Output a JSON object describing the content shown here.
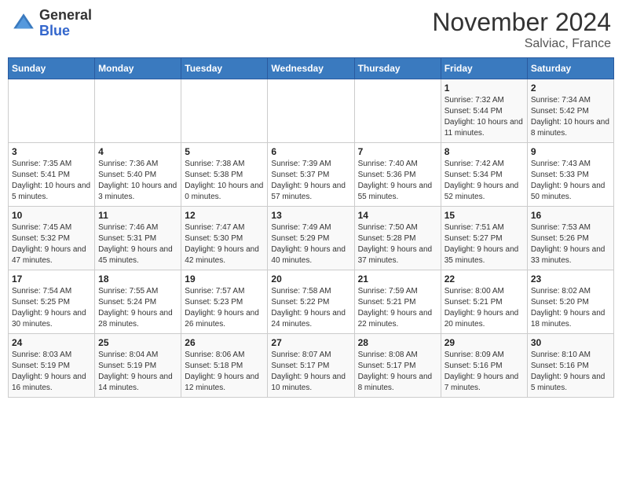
{
  "header": {
    "logo": {
      "general": "General",
      "blue": "Blue"
    },
    "title": "November 2024",
    "location": "Salviac, France"
  },
  "weekdays": [
    "Sunday",
    "Monday",
    "Tuesday",
    "Wednesday",
    "Thursday",
    "Friday",
    "Saturday"
  ],
  "weeks": [
    [
      {
        "day": "",
        "info": ""
      },
      {
        "day": "",
        "info": ""
      },
      {
        "day": "",
        "info": ""
      },
      {
        "day": "",
        "info": ""
      },
      {
        "day": "",
        "info": ""
      },
      {
        "day": "1",
        "info": "Sunrise: 7:32 AM\nSunset: 5:44 PM\nDaylight: 10 hours and 11 minutes."
      },
      {
        "day": "2",
        "info": "Sunrise: 7:34 AM\nSunset: 5:42 PM\nDaylight: 10 hours and 8 minutes."
      }
    ],
    [
      {
        "day": "3",
        "info": "Sunrise: 7:35 AM\nSunset: 5:41 PM\nDaylight: 10 hours and 5 minutes."
      },
      {
        "day": "4",
        "info": "Sunrise: 7:36 AM\nSunset: 5:40 PM\nDaylight: 10 hours and 3 minutes."
      },
      {
        "day": "5",
        "info": "Sunrise: 7:38 AM\nSunset: 5:38 PM\nDaylight: 10 hours and 0 minutes."
      },
      {
        "day": "6",
        "info": "Sunrise: 7:39 AM\nSunset: 5:37 PM\nDaylight: 9 hours and 57 minutes."
      },
      {
        "day": "7",
        "info": "Sunrise: 7:40 AM\nSunset: 5:36 PM\nDaylight: 9 hours and 55 minutes."
      },
      {
        "day": "8",
        "info": "Sunrise: 7:42 AM\nSunset: 5:34 PM\nDaylight: 9 hours and 52 minutes."
      },
      {
        "day": "9",
        "info": "Sunrise: 7:43 AM\nSunset: 5:33 PM\nDaylight: 9 hours and 50 minutes."
      }
    ],
    [
      {
        "day": "10",
        "info": "Sunrise: 7:45 AM\nSunset: 5:32 PM\nDaylight: 9 hours and 47 minutes."
      },
      {
        "day": "11",
        "info": "Sunrise: 7:46 AM\nSunset: 5:31 PM\nDaylight: 9 hours and 45 minutes."
      },
      {
        "day": "12",
        "info": "Sunrise: 7:47 AM\nSunset: 5:30 PM\nDaylight: 9 hours and 42 minutes."
      },
      {
        "day": "13",
        "info": "Sunrise: 7:49 AM\nSunset: 5:29 PM\nDaylight: 9 hours and 40 minutes."
      },
      {
        "day": "14",
        "info": "Sunrise: 7:50 AM\nSunset: 5:28 PM\nDaylight: 9 hours and 37 minutes."
      },
      {
        "day": "15",
        "info": "Sunrise: 7:51 AM\nSunset: 5:27 PM\nDaylight: 9 hours and 35 minutes."
      },
      {
        "day": "16",
        "info": "Sunrise: 7:53 AM\nSunset: 5:26 PM\nDaylight: 9 hours and 33 minutes."
      }
    ],
    [
      {
        "day": "17",
        "info": "Sunrise: 7:54 AM\nSunset: 5:25 PM\nDaylight: 9 hours and 30 minutes."
      },
      {
        "day": "18",
        "info": "Sunrise: 7:55 AM\nSunset: 5:24 PM\nDaylight: 9 hours and 28 minutes."
      },
      {
        "day": "19",
        "info": "Sunrise: 7:57 AM\nSunset: 5:23 PM\nDaylight: 9 hours and 26 minutes."
      },
      {
        "day": "20",
        "info": "Sunrise: 7:58 AM\nSunset: 5:22 PM\nDaylight: 9 hours and 24 minutes."
      },
      {
        "day": "21",
        "info": "Sunrise: 7:59 AM\nSunset: 5:21 PM\nDaylight: 9 hours and 22 minutes."
      },
      {
        "day": "22",
        "info": "Sunrise: 8:00 AM\nSunset: 5:21 PM\nDaylight: 9 hours and 20 minutes."
      },
      {
        "day": "23",
        "info": "Sunrise: 8:02 AM\nSunset: 5:20 PM\nDaylight: 9 hours and 18 minutes."
      }
    ],
    [
      {
        "day": "24",
        "info": "Sunrise: 8:03 AM\nSunset: 5:19 PM\nDaylight: 9 hours and 16 minutes."
      },
      {
        "day": "25",
        "info": "Sunrise: 8:04 AM\nSunset: 5:19 PM\nDaylight: 9 hours and 14 minutes."
      },
      {
        "day": "26",
        "info": "Sunrise: 8:06 AM\nSunset: 5:18 PM\nDaylight: 9 hours and 12 minutes."
      },
      {
        "day": "27",
        "info": "Sunrise: 8:07 AM\nSunset: 5:17 PM\nDaylight: 9 hours and 10 minutes."
      },
      {
        "day": "28",
        "info": "Sunrise: 8:08 AM\nSunset: 5:17 PM\nDaylight: 9 hours and 8 minutes."
      },
      {
        "day": "29",
        "info": "Sunrise: 8:09 AM\nSunset: 5:16 PM\nDaylight: 9 hours and 7 minutes."
      },
      {
        "day": "30",
        "info": "Sunrise: 8:10 AM\nSunset: 5:16 PM\nDaylight: 9 hours and 5 minutes."
      }
    ]
  ]
}
